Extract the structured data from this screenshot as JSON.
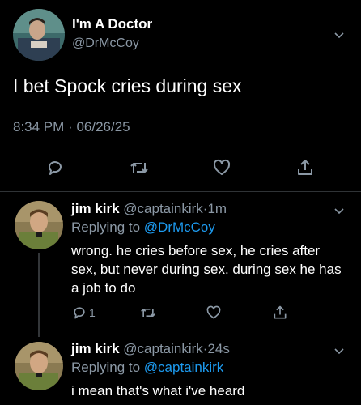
{
  "main_tweet": {
    "display_name": "I'm A Doctor",
    "handle": "@DrMcCoy",
    "text": "I bet Spock cries during sex",
    "time": "8:34 PM",
    "separator": "·",
    "date": "06/26/25"
  },
  "replies": [
    {
      "display_name": "jim kirk",
      "handle": "@captainkirk",
      "separator": "·",
      "age": "1m",
      "replying_prefix": "Replying to",
      "replying_to": "@DrMcCoy",
      "text": "wrong. he cries before sex, he cries after sex, but never during sex. during sex he has a job to do",
      "reply_count": "1"
    },
    {
      "display_name": "jim kirk",
      "handle": "@captainkirk",
      "separator": "·",
      "age": "24s",
      "replying_prefix": "Replying to",
      "replying_to": "@captainkirk",
      "text": "i mean that's what i've heard"
    }
  ],
  "icons": {
    "reply": "reply-icon",
    "retweet": "retweet-icon",
    "like": "heart-icon",
    "share": "share-icon",
    "menu": "chevron-down-icon"
  },
  "colors": {
    "background": "#000000",
    "text": "#ffffff",
    "muted": "#8b98a5",
    "accent": "#1d9bf0",
    "divider": "#2f3336"
  }
}
